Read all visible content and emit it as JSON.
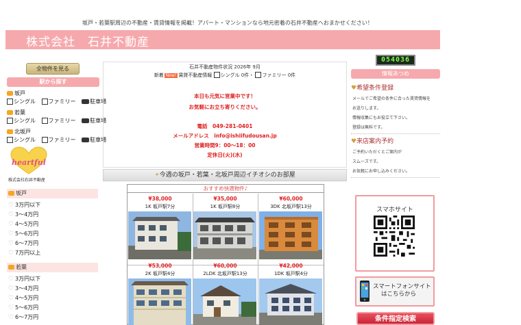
{
  "site": {
    "tagline": "坂戸・若葉駅周辺の不動産・賃貸情報を掲載！アパート・マンションなら地元密着の石井不動産へおまかせください！",
    "company_name": "株式会社　石井不動産",
    "counter": "054036"
  },
  "left": {
    "view_all_label": "全物件を見る",
    "search_by_station_label": "駅から探す",
    "areas": [
      {
        "name": "坂戸",
        "single": "シングル",
        "family": "ファミリー",
        "parking": "駐車場"
      },
      {
        "name": "若葉",
        "single": "シングル",
        "family": "ファミリー",
        "parking": "駐車場"
      },
      {
        "name": "北坂戸",
        "single": "シングル",
        "family": "ファミリー",
        "parking": "駐車場"
      }
    ],
    "logo_text": "heartful",
    "logo_caption": "株式会社石井不動産",
    "price_sections": [
      {
        "area": "坂戸",
        "ranges": [
          "3万円以下",
          "3～4万円",
          "4～5万円",
          "5～6万円",
          "6～7万円",
          "7万円以上"
        ]
      },
      {
        "area": "若葉",
        "ranges": [
          "3万円以下",
          "3～4万円",
          "4～5万円",
          "5～6万円",
          "6～7万円"
        ]
      }
    ]
  },
  "center": {
    "status_title": "石井不動産物件状況 2026年 9月",
    "status_prefix": "新着",
    "new_badge": "New!",
    "status_rent": "賃貸不動産情報",
    "status_single": "シングル",
    "status_single_count": "0件・",
    "status_family": "ファミリー",
    "status_family_count": "0件",
    "messages": [
      "本日も元気に営業中です！",
      "お気軽にお立ち寄りください。",
      "電話　049-281-0401",
      "メールアドレス　info@ishiifudousan.jp",
      "営業時間9：00～18：00",
      "定休日(火)(水)"
    ],
    "weekly_title": "今週の坂戸・若葉・北坂戸周辺イチオシのお部屋",
    "recommend_header": "おすすめ快適物件♪",
    "properties": [
      {
        "price": "¥38,000",
        "desc": "1K 坂戸駅7分"
      },
      {
        "price": "¥35,000",
        "desc": "1K 坂戸駅8分"
      },
      {
        "price": "¥60,000",
        "desc": "3DK 北坂戸駅13分"
      },
      {
        "price": "¥53,000",
        "desc": "2K 坂戸駅4分"
      },
      {
        "price": "¥60,000",
        "desc": "2LDK 北坂戸駅13分"
      },
      {
        "price": "¥42,000",
        "desc": "1DK 坂戸駅4分"
      }
    ]
  },
  "right": {
    "info_head": "情報あつめ",
    "wish_title": "希望条件登録",
    "wish_lines": [
      "メールでご希望の条件に合った賃貸情報を",
      "お送りします。",
      "情報収集にもお役立て下さい。",
      "登録は無料です。"
    ],
    "visit_title": "来店案内予約",
    "visit_lines": [
      "ご予約いただくとご案内が",
      "スムーズです。",
      "お気軽にお申し込みください。"
    ],
    "smartphone_site_title": "スマホサイト",
    "smartphone_btn_line1": "スマートフォンサイト",
    "smartphone_btn_line2": "はこちらから",
    "search_btn_label": "条件指定検索"
  },
  "colors": {
    "accent_pink": "#f6a9ad",
    "price_red": "#e02020",
    "counter_green": "#7cff4a"
  }
}
